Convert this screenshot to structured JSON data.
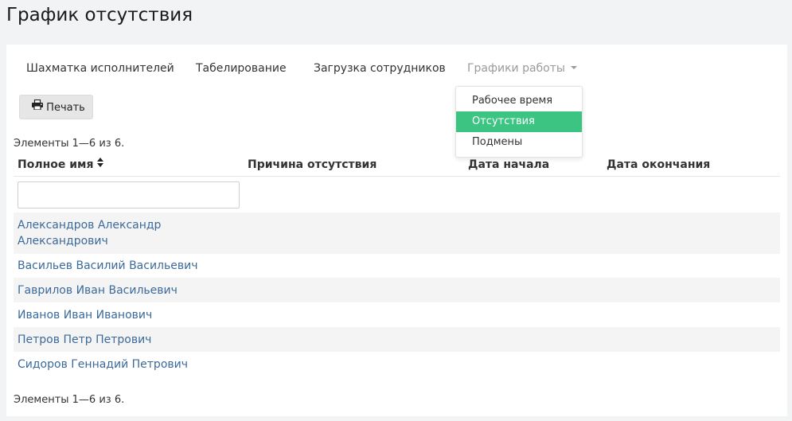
{
  "page": {
    "title": "График отсутствия"
  },
  "tabs": [
    {
      "label": "Шахматка исполнителей"
    },
    {
      "label": "Табелирование"
    },
    {
      "label": "Загрузка сотрудников"
    },
    {
      "label": "Графики работы"
    }
  ],
  "dropdown": {
    "items": [
      {
        "label": "Рабочее время"
      },
      {
        "label": "Отсутствия",
        "active": true
      },
      {
        "label": "Подмены"
      }
    ]
  },
  "toolbar": {
    "print_label": "Печать",
    "print_icon": "printer-icon"
  },
  "summary": {
    "top": "Элементы 1—6 из 6.",
    "bottom": "Элементы 1—6 из 6."
  },
  "table": {
    "columns": [
      "Полное имя",
      "Причина отсутствия",
      "Дата начала",
      "Дата окончания"
    ],
    "filter_value": "",
    "rows": [
      {
        "name_line1": "Александров Александр",
        "name_line2": "Александрович"
      },
      {
        "name_line1": "Васильев Василий Васильевич"
      },
      {
        "name_line1": "Гаврилов Иван Васильевич"
      },
      {
        "name_line1": "Иванов Иван Иванович"
      },
      {
        "name_line1": "Петров Петр Петрович"
      },
      {
        "name_line1": "Сидоров Геннадий Петрович"
      }
    ]
  },
  "colors": {
    "accent": "#3cc483",
    "link": "#3b6a9a",
    "stripe": "#f4f4f4"
  }
}
